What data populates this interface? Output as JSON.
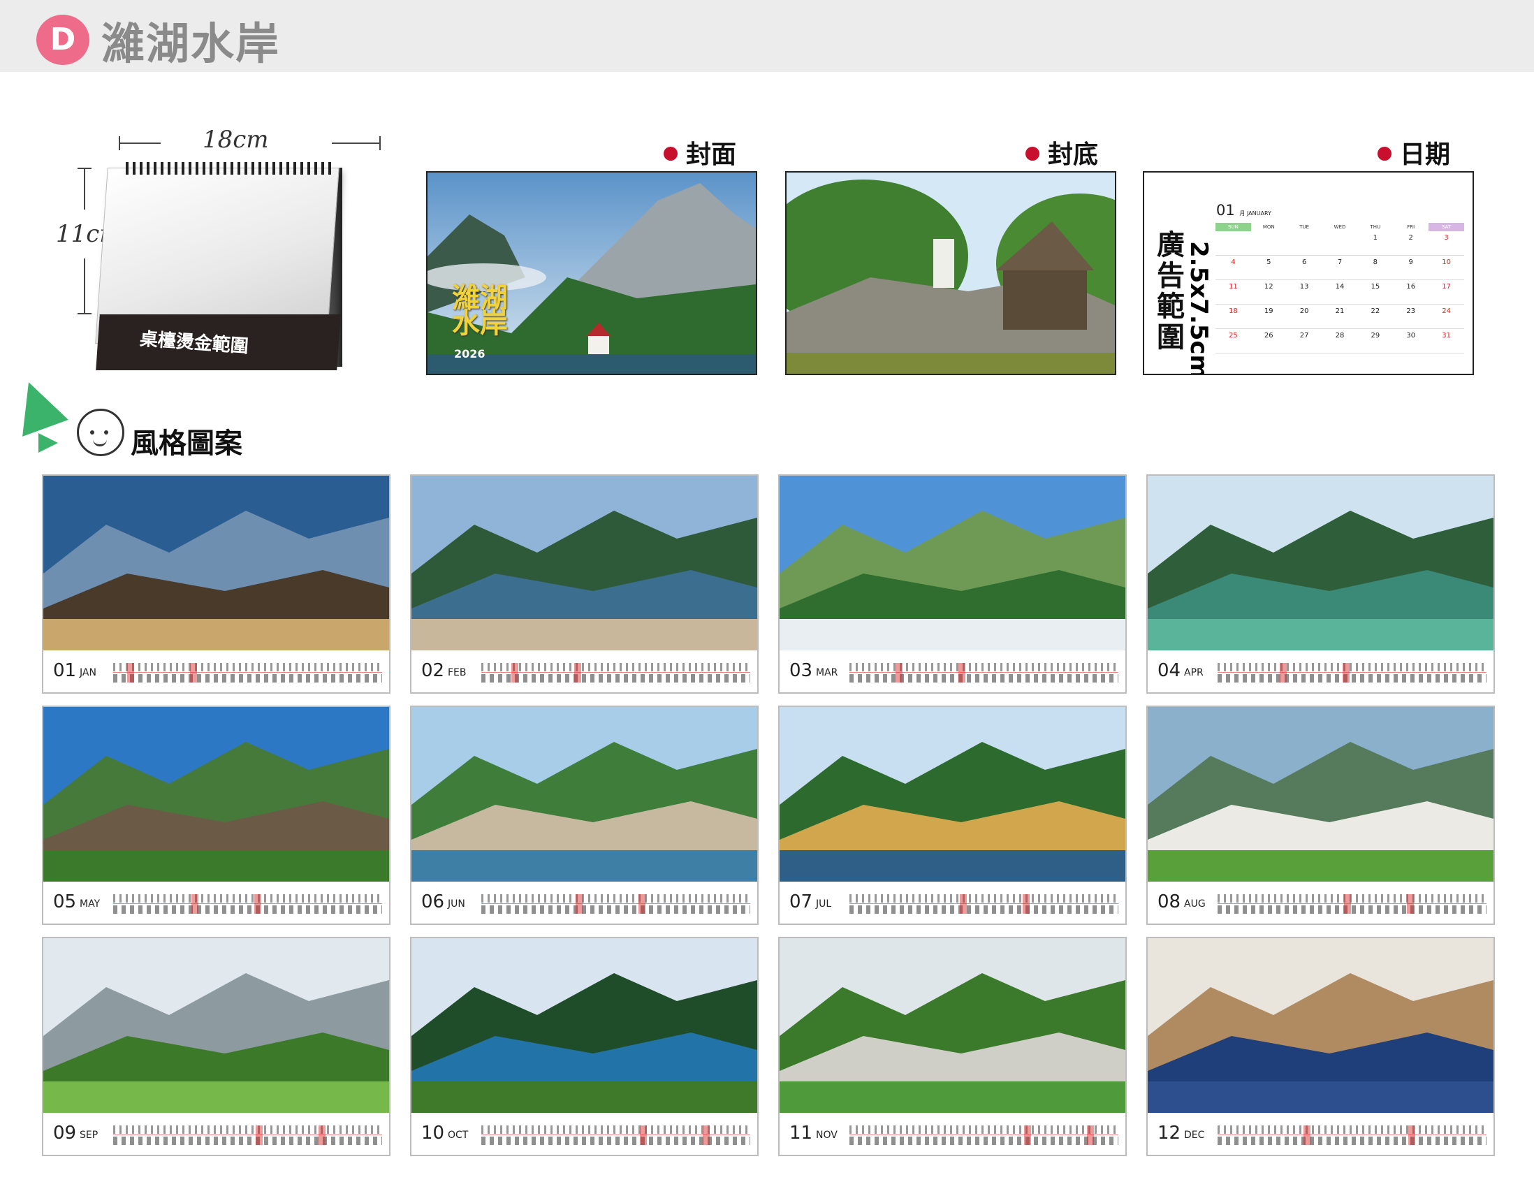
{
  "header": {
    "badge": "D",
    "title": "濰湖水岸"
  },
  "mockup": {
    "width_label": "18cm",
    "height_label": "11cm",
    "base_text": "桌檯燙金範圍"
  },
  "previews": {
    "cover": {
      "label": "封面",
      "title_line1": "濰湖",
      "title_line2": "水岸",
      "year": "2026"
    },
    "back": {
      "label": "封底"
    },
    "date": {
      "label": "日期",
      "ad_text_cn": "廣告範圍",
      "ad_text_en": "2.5x7.5cm",
      "month_num": "01",
      "month_name": "月 JANUARY",
      "weekdays": [
        "SUN",
        "MON",
        "TUE",
        "WED",
        "THU",
        "FRI",
        "SAT"
      ],
      "weeks": [
        [
          "",
          "",
          "",
          "",
          "1",
          "2",
          "3"
        ],
        [
          "4",
          "5",
          "6",
          "7",
          "8",
          "9",
          "10"
        ],
        [
          "11",
          "12",
          "13",
          "14",
          "15",
          "16",
          "17"
        ],
        [
          "18",
          "19",
          "20",
          "21",
          "22",
          "23",
          "24"
        ],
        [
          "25",
          "26",
          "27",
          "28",
          "29",
          "30",
          "31"
        ]
      ]
    }
  },
  "style_label": "風格圖案",
  "months": [
    {
      "num": "01",
      "abbr": "JAN",
      "colors": [
        "#2a5d92",
        "#6f8fb0",
        "#4a3a2a",
        "#c9a66b"
      ]
    },
    {
      "num": "02",
      "abbr": "FEB",
      "colors": [
        "#8fb4d8",
        "#2e5a3a",
        "#3b6e8f",
        "#c8b79a"
      ]
    },
    {
      "num": "03",
      "abbr": "MAR",
      "colors": [
        "#4f93d6",
        "#6e9a55",
        "#2f6e2f",
        "#e9eef2"
      ]
    },
    {
      "num": "04",
      "abbr": "APR",
      "colors": [
        "#cfe2ef",
        "#2f5f3a",
        "#3a8a77",
        "#5ab49a"
      ]
    },
    {
      "num": "05",
      "abbr": "MAY",
      "colors": [
        "#2c78c4",
        "#467a3a",
        "#6b5a46",
        "#3b7a2a"
      ]
    },
    {
      "num": "06",
      "abbr": "JUN",
      "colors": [
        "#a7cde9",
        "#3f7e3a",
        "#c7b8a0",
        "#3e7fa6"
      ]
    },
    {
      "num": "07",
      "abbr": "JUL",
      "colors": [
        "#c7dff0",
        "#2d6a2d",
        "#d2a64c",
        "#2f5e86"
      ]
    },
    {
      "num": "08",
      "abbr": "AUG",
      "colors": [
        "#8ab0cc",
        "#557b5c",
        "#eceae4",
        "#5aa03a"
      ]
    },
    {
      "num": "09",
      "abbr": "SEP",
      "colors": [
        "#e1e8ee",
        "#8d9a9f",
        "#3c7a2a",
        "#77b84a"
      ]
    },
    {
      "num": "10",
      "abbr": "OCT",
      "colors": [
        "#d8e4ef",
        "#1f4d2a",
        "#2274a8",
        "#3f7a2a"
      ]
    },
    {
      "num": "11",
      "abbr": "NOV",
      "colors": [
        "#dfe6ea",
        "#3a7a2a",
        "#cfcfc8",
        "#4f9a3a"
      ]
    },
    {
      "num": "12",
      "abbr": "DEC",
      "colors": [
        "#e9e4dc",
        "#b08a60",
        "#1f3f7a",
        "#2d4f8e"
      ]
    }
  ]
}
